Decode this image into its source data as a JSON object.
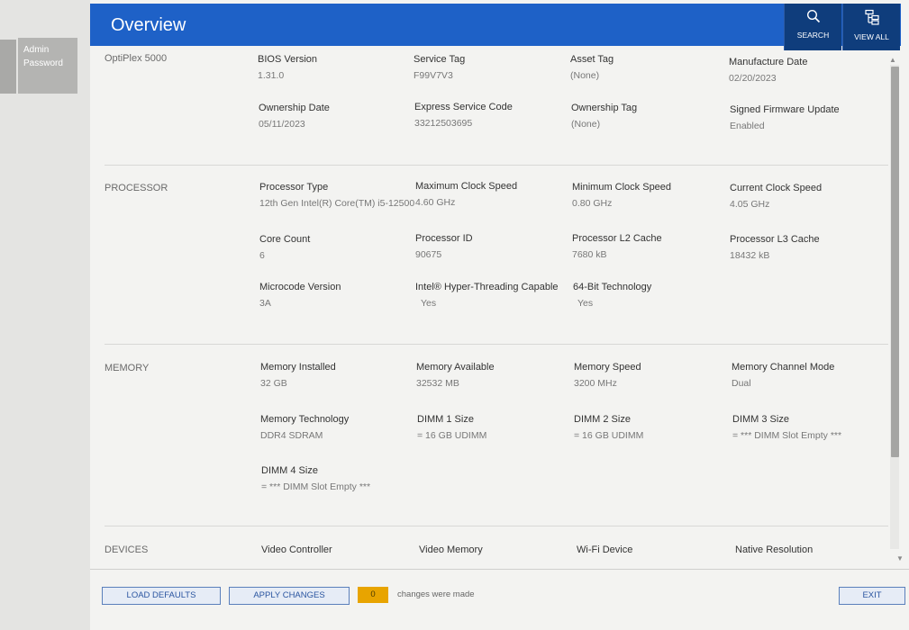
{
  "sidebar": {
    "tab_label": "Admin Password"
  },
  "header": {
    "title": "Overview",
    "search_label": "SEARCH",
    "view_all_label": "VIEW ALL",
    "color": "#1e61c7"
  },
  "system": {
    "name": "OptiPlex 5000",
    "fields": [
      {
        "label": "BIOS Version",
        "value": "1.31.0"
      },
      {
        "label": "Service Tag",
        "value": "F99V7V3"
      },
      {
        "label": "Asset Tag",
        "value": "(None)"
      },
      {
        "label": "Manufacture Date",
        "value": "02/20/2023"
      },
      {
        "label": "Ownership Date",
        "value": "05/11/2023"
      },
      {
        "label": "Express Service Code",
        "value": "33212503695"
      },
      {
        "label": "Ownership Tag",
        "value": "(None)"
      },
      {
        "label": "Signed Firmware Update",
        "value": "Enabled"
      }
    ]
  },
  "processor": {
    "name": "PROCESSOR",
    "fields": [
      {
        "label": "Processor Type",
        "value": "12th Gen Intel(R) Core(TM) i5-12500"
      },
      {
        "label": "Maximum Clock Speed",
        "value": "4.60 GHz"
      },
      {
        "label": "Minimum Clock Speed",
        "value": "0.80 GHz"
      },
      {
        "label": "Current Clock Speed",
        "value": "4.05 GHz"
      },
      {
        "label": "Core Count",
        "value": "6"
      },
      {
        "label": "Processor ID",
        "value": "90675"
      },
      {
        "label": "Processor L2 Cache",
        "value": "7680 kB"
      },
      {
        "label": "Processor L3 Cache",
        "value": "18432 kB"
      },
      {
        "label": "Microcode Version",
        "value": "3A"
      },
      {
        "label": "Intel® Hyper-Threading Capable",
        "value": "Yes"
      },
      {
        "label": "64-Bit Technology",
        "value": "Yes"
      }
    ]
  },
  "memory": {
    "name": "MEMORY",
    "fields": [
      {
        "label": "Memory Installed",
        "value": "32 GB"
      },
      {
        "label": "Memory Available",
        "value": "32532 MB"
      },
      {
        "label": "Memory Speed",
        "value": "3200 MHz"
      },
      {
        "label": "Memory Channel Mode",
        "value": "Dual"
      },
      {
        "label": "Memory Technology",
        "value": "DDR4 SDRAM"
      },
      {
        "label": "DIMM 1 Size",
        "value": "= 16 GB UDIMM"
      },
      {
        "label": "DIMM 2 Size",
        "value": "= 16 GB UDIMM"
      },
      {
        "label": "DIMM 3 Size",
        "value": "= *** DIMM Slot Empty ***"
      },
      {
        "label": "DIMM 4 Size",
        "value": "= *** DIMM Slot Empty ***"
      }
    ]
  },
  "devices": {
    "name": "DEVICES",
    "fields": [
      {
        "label": "Video Controller",
        "value": ""
      },
      {
        "label": "Video Memory",
        "value": ""
      },
      {
        "label": "Wi-Fi Device",
        "value": ""
      },
      {
        "label": "Native Resolution",
        "value": ""
      }
    ]
  },
  "footer": {
    "load_defaults_label": "LOAD DEFAULTS",
    "apply_changes_label": "APPLY CHANGES",
    "changes_count": "0",
    "changes_text": "changes were made",
    "exit_label": "EXIT",
    "changes_color": "#e8a400"
  }
}
